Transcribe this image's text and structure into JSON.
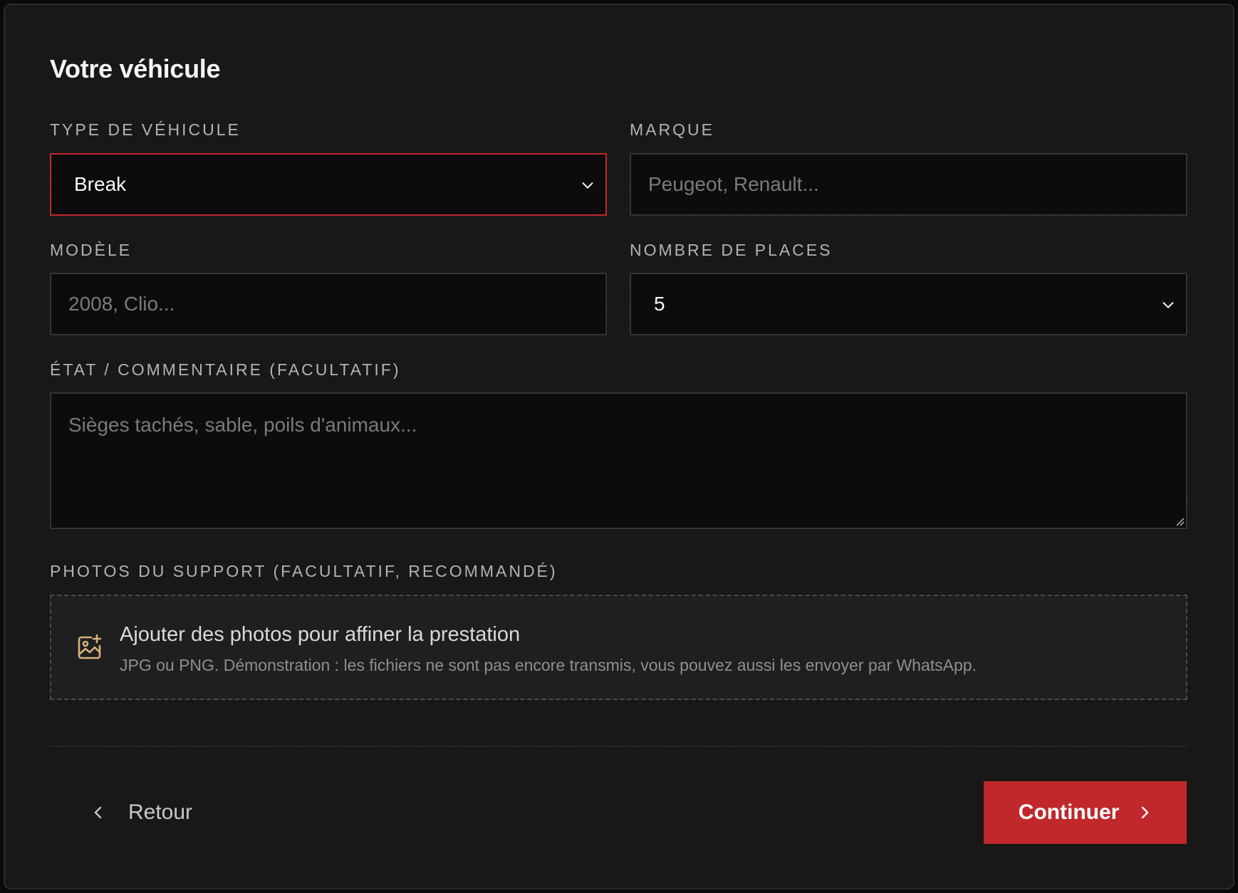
{
  "section": {
    "title": "Votre véhicule"
  },
  "fields": {
    "vehicle_type": {
      "label": "TYPE DE VÉHICULE",
      "value": "Break"
    },
    "brand": {
      "label": "MARQUE",
      "placeholder": "Peugeot, Renault..."
    },
    "model": {
      "label": "MODÈLE",
      "placeholder": "2008, Clio..."
    },
    "seats": {
      "label": "NOMBRE DE PLACES",
      "value": "5"
    },
    "comment": {
      "label": "ÉTAT / COMMENTAIRE (FACULTATIF)",
      "placeholder": "Sièges tachés, sable, poils d'animaux..."
    },
    "photos": {
      "label": "PHOTOS DU SUPPORT (FACULTATIF, RECOMMANDÉ)",
      "title": "Ajouter des photos pour affiner la prestation",
      "description": "JPG ou PNG. Démonstration : les fichiers ne sont pas encore transmis, vous pouvez aussi les envoyer par WhatsApp.",
      "icon": "image-add-icon"
    }
  },
  "actions": {
    "back_label": "Retour",
    "continue_label": "Continuer"
  },
  "colors": {
    "accent": "#c0282b",
    "icon_accent": "#d9b27a",
    "background": "#161616"
  }
}
